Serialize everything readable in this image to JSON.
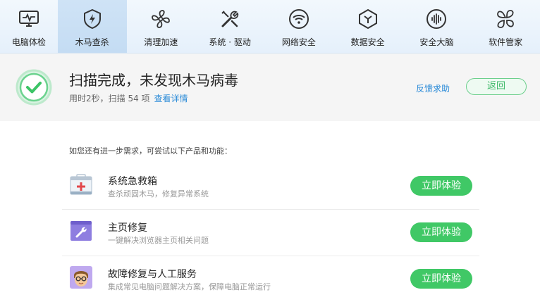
{
  "nav": {
    "items": [
      {
        "label": "电脑体检",
        "icon": "monitor-pulse-icon"
      },
      {
        "label": "木马查杀",
        "icon": "shield-lightning-icon",
        "active": true
      },
      {
        "label": "清理加速",
        "icon": "fan-icon"
      },
      {
        "label": "系统 · 驱动",
        "icon": "tools-icon"
      },
      {
        "label": "网络安全",
        "icon": "wifi-icon"
      },
      {
        "label": "数据安全",
        "icon": "cube-icon"
      },
      {
        "label": "安全大脑",
        "icon": "brain-waves-icon"
      },
      {
        "label": "软件管家",
        "icon": "app-grid-icon"
      }
    ]
  },
  "result": {
    "title": "扫描完成，未发现木马病毒",
    "subtitle": "用时2秒，扫描 54 项",
    "detail_link": "查看详情",
    "feedback_link": "反馈求助",
    "back_label": "返回"
  },
  "suggestions": {
    "title": "如您还有进一步需求，可尝试以下产品和功能：",
    "items": [
      {
        "title": "系统急救箱",
        "desc": "查杀顽固木马，修复异常系统",
        "button": "立即体验",
        "icon": "first-aid-kit-icon"
      },
      {
        "title": "主页修复",
        "desc": "一键解决浏览器主页相关问题",
        "button": "立即体验",
        "icon": "wrench-window-icon"
      },
      {
        "title": "故障修复与人工服务",
        "desc": "集成常见电脑问题解决方案，保障电脑正常运行",
        "button": "立即体验",
        "icon": "support-agent-icon"
      }
    ]
  },
  "colors": {
    "accent_green": "#40c866",
    "link_blue": "#2b8bd8",
    "nav_bg": "#e5f0fb"
  }
}
